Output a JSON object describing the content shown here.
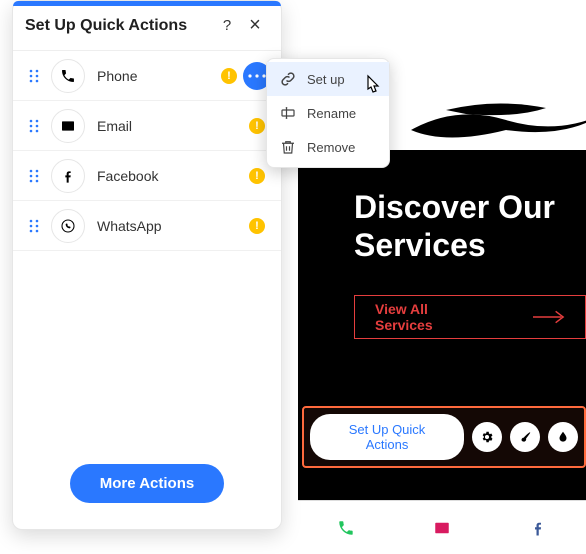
{
  "panel": {
    "title": "Set Up Quick Actions",
    "items": [
      {
        "label": "Phone"
      },
      {
        "label": "Email"
      },
      {
        "label": "Facebook"
      },
      {
        "label": "WhatsApp"
      }
    ],
    "more_actions_label": "More Actions"
  },
  "context_menu": {
    "items": [
      {
        "label": "Set up"
      },
      {
        "label": "Rename"
      },
      {
        "label": "Remove"
      }
    ]
  },
  "preview": {
    "hero_line1": "Discover Our",
    "hero_line2": "Services",
    "view_all_label": "View All Services",
    "chip_label": "Set Up Quick Actions"
  },
  "colors": {
    "accent_blue": "#2a78ff",
    "warning": "#ffc300",
    "cta_red": "#e53e3e",
    "selection_orange": "#ff6a3d"
  }
}
